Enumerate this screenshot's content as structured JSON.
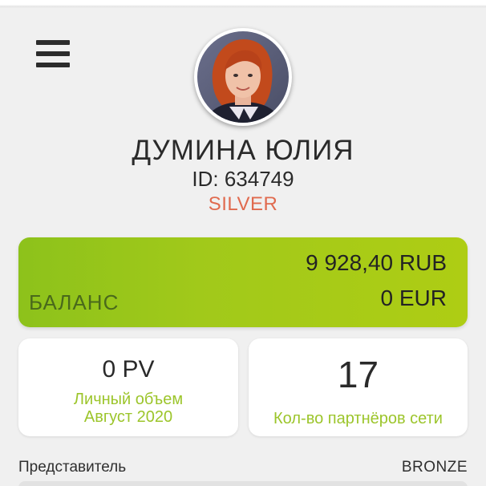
{
  "header": {
    "menu_icon": "hamburger-menu-icon",
    "avatar_icon": "user-avatar"
  },
  "profile": {
    "name": "ДУМИНА ЮЛИЯ",
    "id_text": "ID: 634749",
    "rank": "SILVER",
    "rank_color": "#e06a4e"
  },
  "balance": {
    "label": "БАЛАНС",
    "rub": "9 928,40 RUB",
    "eur": "0 EUR",
    "accent_color": "#a1c91a"
  },
  "cards": {
    "personal_volume": {
      "value": "0 PV",
      "label_line1": "Личный объем",
      "label_line2": "Август 2020"
    },
    "partners": {
      "value": "17",
      "label": "Кол-во партнёров сети"
    }
  },
  "status": {
    "left": "Представитель",
    "right": "BRONZE"
  }
}
